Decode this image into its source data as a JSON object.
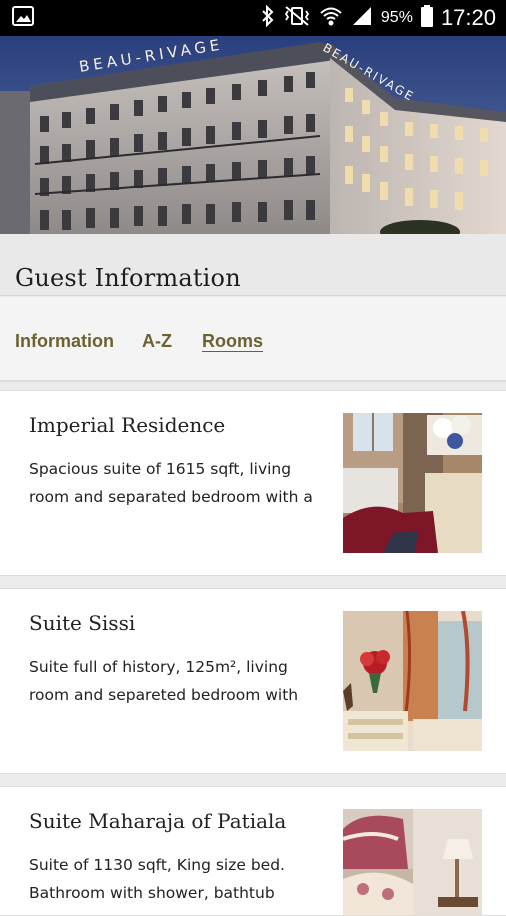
{
  "status_bar": {
    "battery_percent": "95%",
    "time": "17:20",
    "icons": [
      "image-icon",
      "bluetooth-icon",
      "vibrate-icon",
      "wifi-icon",
      "signal-icon",
      "battery-icon"
    ]
  },
  "hero": {
    "sign_text_left": "BEAU-RIVAGE",
    "sign_text_right": "BEAU-RIVAGE"
  },
  "page": {
    "title": "Guest Information"
  },
  "tabs": [
    {
      "label": "Information",
      "active": false
    },
    {
      "label": "A-Z",
      "active": false
    },
    {
      "label": "Rooms",
      "active": true
    }
  ],
  "rooms": [
    {
      "title": "Imperial Residence",
      "description": "Spacious suite of 1615 sqft, living room and separated bedroom with a"
    },
    {
      "title": "Suite Sissi",
      "description": "Suite full of history, 125m², living room and separeted bedroom with"
    },
    {
      "title": "Suite Maharaja of Patiala",
      "description": "Suite of 1130 sqft, King size bed. Bathroom with shower, bathtub"
    }
  ]
}
